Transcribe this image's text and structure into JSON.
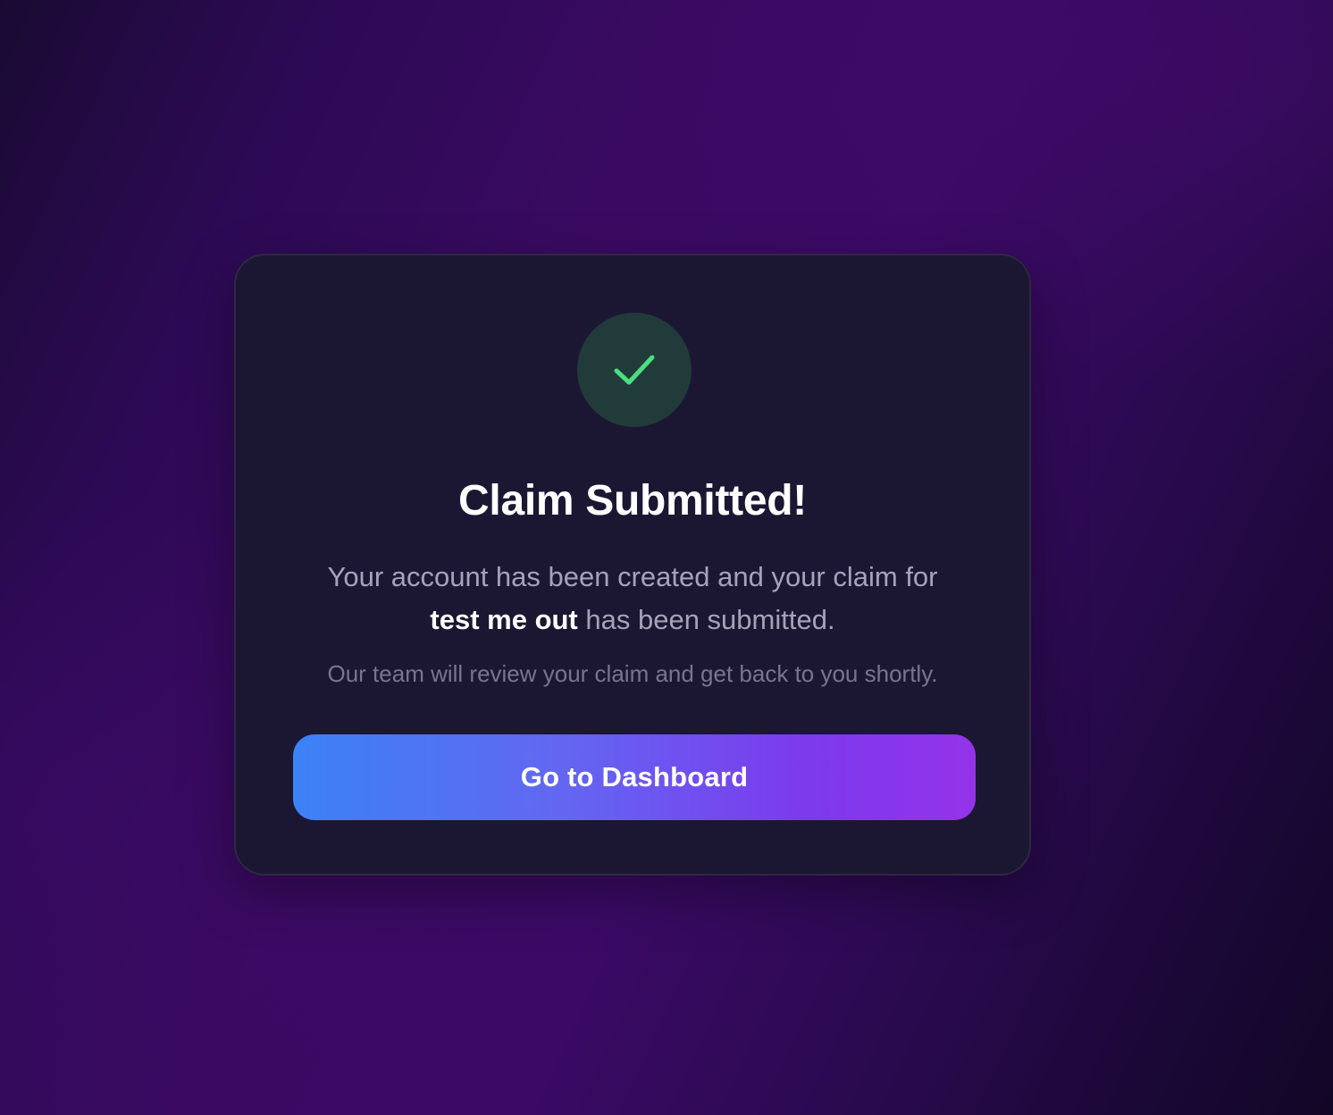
{
  "confirmation": {
    "icon": "checkmark-icon",
    "title": "Claim Submitted!",
    "message_prefix": "Your account has been created and your claim for",
    "claim_name": "test me out",
    "message_suffix": "has been submitted.",
    "note": "Our team will review your claim and get back to you shortly.",
    "cta_label": "Go to Dashboard"
  },
  "colors": {
    "success": "#4ade80",
    "button_gradient_start": "#3b82f6",
    "button_gradient_end": "#9333ea",
    "card_background": "#1b1732"
  }
}
